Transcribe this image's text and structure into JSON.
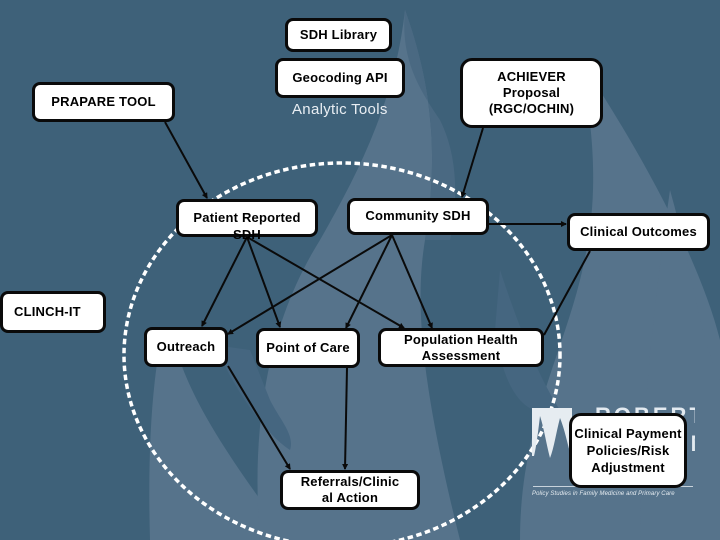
{
  "diagram": {
    "nodes": [
      {
        "id": "sdh-library",
        "label": "SDH Library"
      },
      {
        "id": "geocoding-api",
        "label": "Geocoding API"
      },
      {
        "id": "prapare-tool",
        "label": "PRAPARE TOOL"
      },
      {
        "id": "achiever",
        "label": "ACHIEVER\nProposal\n(RGC/OCHIN)"
      },
      {
        "id": "patient-reported-sdh",
        "label": "Patient Reported\nSDH"
      },
      {
        "id": "community-sdh",
        "label": "Community SDH"
      },
      {
        "id": "clinical-outcomes",
        "label": "Clinical Outcomes"
      },
      {
        "id": "clinch-it",
        "label": "CLINCH-IT"
      },
      {
        "id": "outreach",
        "label": "Outreach"
      },
      {
        "id": "point-of-care",
        "label": "Point of Care"
      },
      {
        "id": "population-health",
        "label": "Population Health\nAssessment"
      },
      {
        "id": "referrals",
        "label": "Referrals/Clinic\nal Action"
      },
      {
        "id": "clinical-payment",
        "label": "Clinical Payment\nPolicies/Risk\nAdjustment"
      }
    ],
    "group_label": "Analytic Tools",
    "edges": [
      {
        "from": "prapare-tool",
        "to": "patient-reported-sdh"
      },
      {
        "from": "achiever",
        "to": "community-sdh"
      },
      {
        "from": "community-sdh",
        "to": "clinical-outcomes"
      },
      {
        "from": "patient-reported-sdh",
        "to": "outreach"
      },
      {
        "from": "patient-reported-sdh",
        "to": "point-of-care"
      },
      {
        "from": "patient-reported-sdh",
        "to": "population-health"
      },
      {
        "from": "community-sdh",
        "to": "outreach"
      },
      {
        "from": "community-sdh",
        "to": "point-of-care"
      },
      {
        "from": "community-sdh",
        "to": "population-health"
      },
      {
        "from": "population-health",
        "to": "clinical-outcomes"
      },
      {
        "from": "outreach",
        "to": "referrals"
      },
      {
        "from": "point-of-care",
        "to": "referrals"
      }
    ]
  },
  "logo": {
    "name": "ROBERT GRAHAM CENTER",
    "tagline": "Policy Studies in Family Medicine and Primary Care"
  },
  "colors": {
    "background": "#3e6179",
    "flame": "#56738b",
    "node_fill": "#ffffff",
    "node_border": "#0a0a0a",
    "dotted_circle": "#ffffff"
  }
}
